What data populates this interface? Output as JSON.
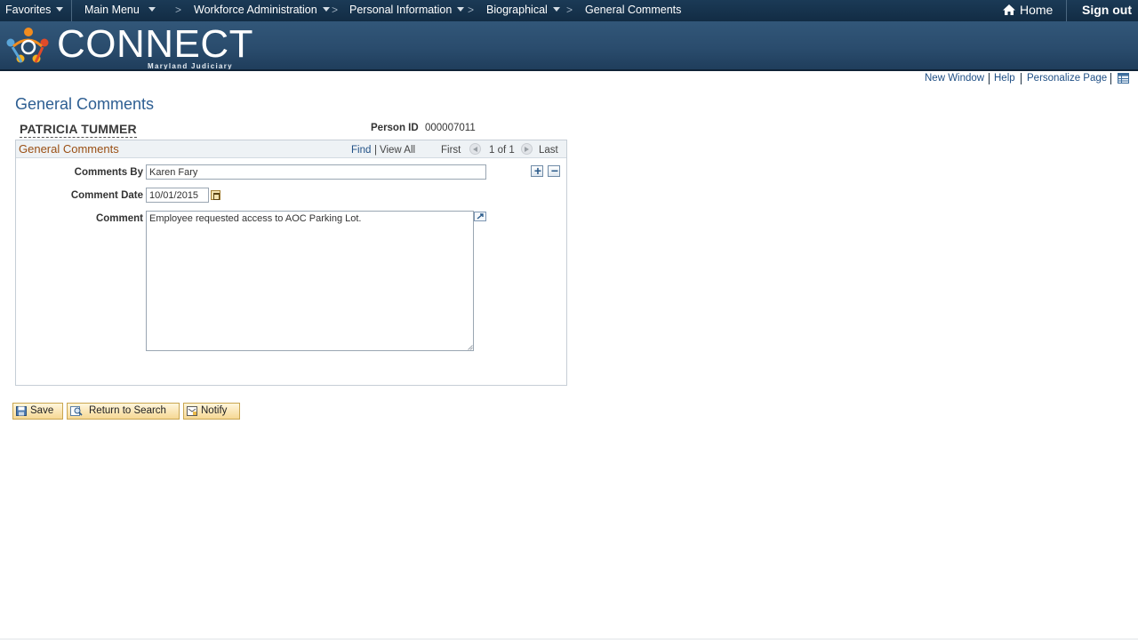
{
  "nav": {
    "favorites": "Favorites",
    "main_menu": "Main Menu",
    "breadcrumbs": [
      "Workforce Administration",
      "Personal Information",
      "Biographical",
      "General Comments"
    ],
    "separator": ">",
    "home": "Home",
    "sign_out": "Sign out"
  },
  "banner": {
    "logo_text": "CONNECT",
    "logo_subtext": "Maryland Judiciary"
  },
  "page_links": [
    "New Window",
    "Help",
    "Personalize Page"
  ],
  "page": {
    "title": "General Comments",
    "employee_name": "PATRICIA TUMMER",
    "person_id_label": "Person ID",
    "person_id": "000007011"
  },
  "panel": {
    "title": "General Comments",
    "find": "Find",
    "view_all": "View All",
    "first": "First",
    "count": "1 of 1",
    "last": "Last",
    "add_symbol": "+",
    "remove_symbol": "−"
  },
  "fields": {
    "comments_by_label": "Comments By",
    "comments_by_value": "Karen Fary",
    "comment_date_label": "Comment Date",
    "comment_date_value": "10/01/2015",
    "comment_label": "Comment",
    "comment_value": "Employee requested access to AOC Parking Lot."
  },
  "buttons": {
    "save": "Save",
    "return_to_search": "Return to Search",
    "notify": "Notify"
  },
  "colors": {
    "nav_bg": "#1b3a56",
    "banner_bg": "#2a4c6d",
    "link": "#1f4f85",
    "title": "#2d5e92",
    "panel_title": "#9a4f14",
    "button_bg": "#f6d894"
  }
}
